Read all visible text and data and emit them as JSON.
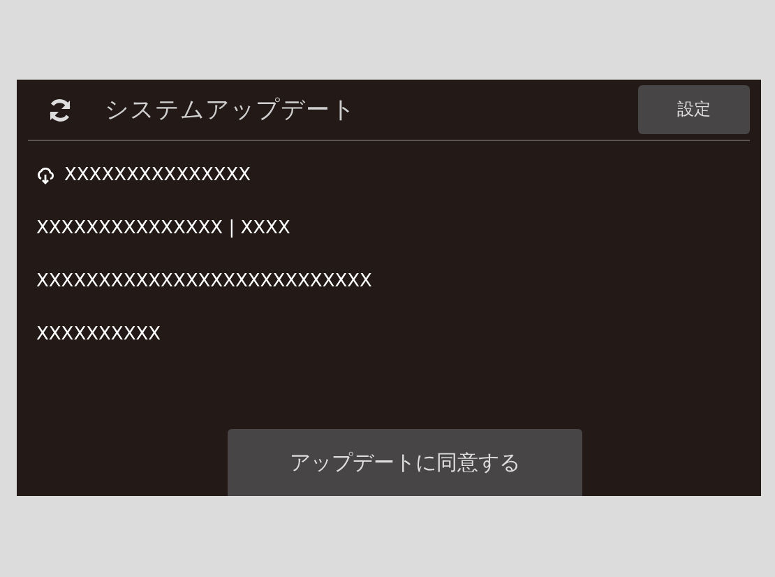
{
  "header": {
    "title": "システムアップデート",
    "settings_button": "設定"
  },
  "lines": [
    {
      "kind": "cloud",
      "text": "XXXXXXXXXXXXXXX"
    },
    {
      "kind": "plain",
      "text": "XXXXXXXXXXXXXXX | XXXX"
    },
    {
      "kind": "plain",
      "text": "XXXXXXXXXXXXXXXXXXXXXXXXXXX"
    },
    {
      "kind": "plain",
      "text": "XXXXXXXXXX"
    }
  ],
  "agree_button": "アップデートに同意する"
}
